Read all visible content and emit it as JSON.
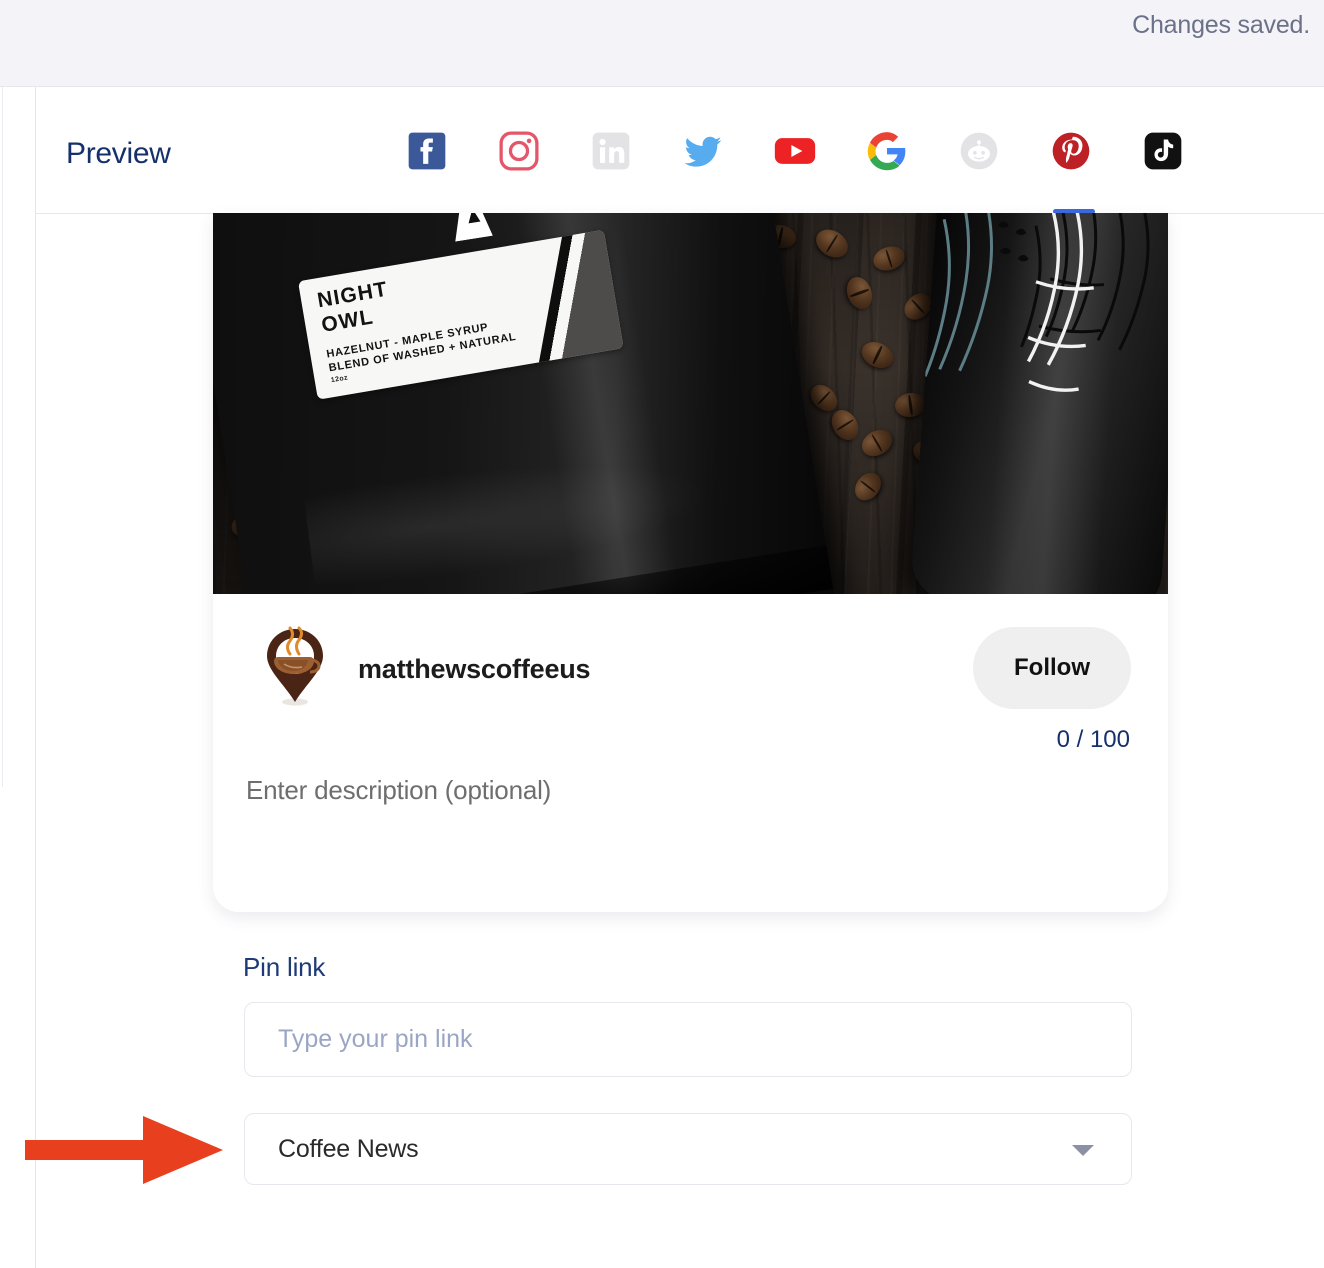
{
  "topbar": {
    "status_message": "Changes saved."
  },
  "preview": {
    "title": "Preview",
    "tabs": [
      {
        "name": "facebook",
        "label": "Facebook",
        "active": false,
        "color": "#3b5998"
      },
      {
        "name": "instagram",
        "label": "Instagram",
        "active": false,
        "color": "#e4566a"
      },
      {
        "name": "linkedin",
        "label": "LinkedIn",
        "active": false,
        "color": "#e3e3e6"
      },
      {
        "name": "twitter",
        "label": "Twitter",
        "active": false,
        "color": "#56acee"
      },
      {
        "name": "youtube",
        "label": "YouTube",
        "active": false,
        "color": "#ed2224"
      },
      {
        "name": "google",
        "label": "Google",
        "active": false,
        "color": "#4285f4"
      },
      {
        "name": "reddit",
        "label": "Reddit",
        "active": false,
        "color": "#e3e3e6"
      },
      {
        "name": "pinterest",
        "label": "Pinterest",
        "active": true,
        "color": "#bd2025"
      },
      {
        "name": "tiktok",
        "label": "TikTok",
        "active": false,
        "color": "#111111"
      }
    ],
    "active_tab_indicator_color": "#3b6ae1"
  },
  "post_card": {
    "image": {
      "alt": "Black coffee bag and tumbler on dark wood with coffee beans",
      "bag_label": {
        "title_line1": "NIGHT",
        "title_line2": "OWL",
        "subtitle_line1": "HAZELNUT - MAPLE SYRUP",
        "subtitle_line2": "BLEND OF WASHED + NATURAL",
        "size": "12oz"
      }
    },
    "account": {
      "handle": "matthewscoffeeus",
      "avatar_name": "coffee-pin-avatar"
    },
    "follow_button_label": "Follow",
    "character_counter": "0 / 100",
    "description_placeholder": "Enter description (optional)"
  },
  "pin_link": {
    "label": "Pin link",
    "input_value": "",
    "input_placeholder": "Type your pin link"
  },
  "board_select": {
    "selected_value": "Coffee News",
    "caret_icon": "chevron-down-icon"
  },
  "annotation": {
    "arrow_color": "#e8401f",
    "points_to": "board-select"
  }
}
